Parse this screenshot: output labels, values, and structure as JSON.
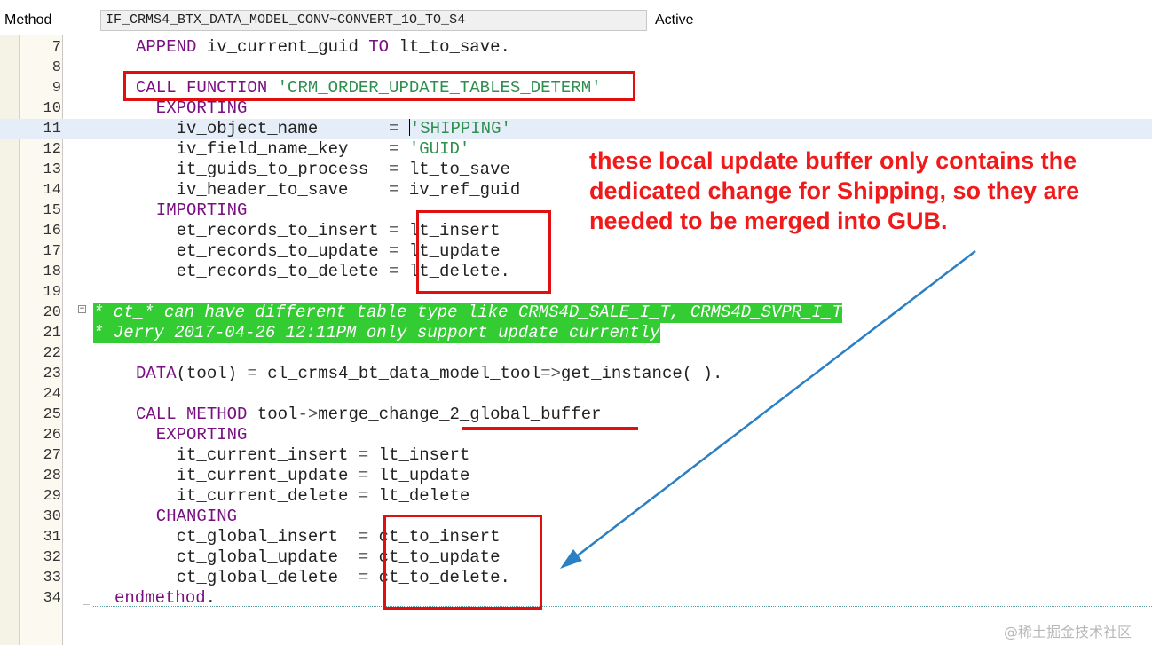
{
  "header": {
    "object_type_label": "Method",
    "method_name": "IF_CRMS4_BTX_DATA_MODEL_CONV~CONVERT_1O_TO_S4",
    "status": "Active"
  },
  "code_lines": [
    {
      "n": "7",
      "segs": [
        {
          "t": "APPEND",
          "c": "kw"
        },
        {
          "t": " iv_current_guid "
        },
        {
          "t": "TO",
          "c": "kw"
        },
        {
          "t": " lt_to_save."
        }
      ]
    },
    {
      "n": "8",
      "segs": []
    },
    {
      "n": "9",
      "segs": [
        {
          "t": "CALL FUNCTION",
          "c": "kw"
        },
        {
          "t": " "
        },
        {
          "t": "'CRM_ORDER_UPDATE_TABLES_DETERM'",
          "c": "str"
        }
      ]
    },
    {
      "n": "10",
      "segs": [
        {
          "t": "  EXPORTING",
          "c": "kw"
        }
      ]
    },
    {
      "n": "11",
      "segs": [
        {
          "t": "    iv_object_name       "
        },
        {
          "t": "=",
          "c": "op"
        },
        {
          "t": " "
        },
        {
          "t": "",
          "cursor": true
        },
        {
          "t": "'SHIPPING'",
          "c": "str"
        }
      ]
    },
    {
      "n": "12",
      "segs": [
        {
          "t": "    iv_field_name_key    "
        },
        {
          "t": "=",
          "c": "op"
        },
        {
          "t": " "
        },
        {
          "t": "'GUID'",
          "c": "str"
        }
      ]
    },
    {
      "n": "13",
      "segs": [
        {
          "t": "    it_guids_to_process  "
        },
        {
          "t": "=",
          "c": "op"
        },
        {
          "t": " lt_to_save"
        }
      ]
    },
    {
      "n": "14",
      "segs": [
        {
          "t": "    iv_header_to_save    "
        },
        {
          "t": "=",
          "c": "op"
        },
        {
          "t": " iv_ref_guid"
        }
      ]
    },
    {
      "n": "15",
      "segs": [
        {
          "t": "  IMPORTING",
          "c": "kw"
        }
      ]
    },
    {
      "n": "16",
      "segs": [
        {
          "t": "    et_records_to_insert "
        },
        {
          "t": "=",
          "c": "op"
        },
        {
          "t": " lt_insert"
        }
      ]
    },
    {
      "n": "17",
      "segs": [
        {
          "t": "    et_records_to_update "
        },
        {
          "t": "=",
          "c": "op"
        },
        {
          "t": " lt_update"
        }
      ]
    },
    {
      "n": "18",
      "segs": [
        {
          "t": "    et_records_to_delete "
        },
        {
          "t": "=",
          "c": "op"
        },
        {
          "t": " lt_delete."
        }
      ]
    },
    {
      "n": "19",
      "segs": []
    },
    {
      "n": "20",
      "comment": "* ct_* can have different table type like CRMS4D_SALE_I_T, CRMS4D_SVPR_I_T"
    },
    {
      "n": "21",
      "comment": "* Jerry 2017-04-26 12:11PM only support update currently"
    },
    {
      "n": "22",
      "segs": []
    },
    {
      "n": "23",
      "segs": [
        {
          "t": "DATA",
          "c": "kw"
        },
        {
          "t": "(tool) "
        },
        {
          "t": "=",
          "c": "op"
        },
        {
          "t": " cl_crms4_bt_data_model_tool"
        },
        {
          "t": "=>",
          "c": "op"
        },
        {
          "t": "get_instance( )."
        }
      ]
    },
    {
      "n": "24",
      "segs": []
    },
    {
      "n": "25",
      "segs": [
        {
          "t": "CALL METHOD",
          "c": "kw"
        },
        {
          "t": " tool"
        },
        {
          "t": "->",
          "c": "op"
        },
        {
          "t": "merge_change_2_global_buffer"
        }
      ]
    },
    {
      "n": "26",
      "segs": [
        {
          "t": "  EXPORTING",
          "c": "kw"
        }
      ]
    },
    {
      "n": "27",
      "segs": [
        {
          "t": "    it_current_insert "
        },
        {
          "t": "=",
          "c": "op"
        },
        {
          "t": " lt_insert"
        }
      ]
    },
    {
      "n": "28",
      "segs": [
        {
          "t": "    it_current_update "
        },
        {
          "t": "=",
          "c": "op"
        },
        {
          "t": " lt_update"
        }
      ]
    },
    {
      "n": "29",
      "segs": [
        {
          "t": "    it_current_delete "
        },
        {
          "t": "=",
          "c": "op"
        },
        {
          "t": " lt_delete"
        }
      ]
    },
    {
      "n": "30",
      "segs": [
        {
          "t": "  CHANGING",
          "c": "kw"
        }
      ]
    },
    {
      "n": "31",
      "segs": [
        {
          "t": "    ct_global_insert  "
        },
        {
          "t": "=",
          "c": "op"
        },
        {
          "t": " ct_to_insert"
        }
      ]
    },
    {
      "n": "32",
      "segs": [
        {
          "t": "    ct_global_update  "
        },
        {
          "t": "=",
          "c": "op"
        },
        {
          "t": " ct_to_update"
        }
      ]
    },
    {
      "n": "33",
      "segs": [
        {
          "t": "    ct_global_delete  "
        },
        {
          "t": "=",
          "c": "op"
        },
        {
          "t": " ct_to_delete."
        }
      ]
    },
    {
      "n": "34",
      "segs": [
        {
          "t": "endmethod",
          "c": "kw"
        },
        {
          "t": "."
        }
      ]
    }
  ],
  "annotation": {
    "text": "these local update buffer only contains the dedicated change for Shipping, so they are needed to be merged into GUB.",
    "color": "#f01a1a"
  },
  "watermark": "@稀土掘金技术社区",
  "colors": {
    "keyword": "#7a0f82",
    "string": "#2f8f4f",
    "comment_bg": "#33cc33",
    "highlight": "#e01010",
    "arrow": "#2b7fc4"
  }
}
